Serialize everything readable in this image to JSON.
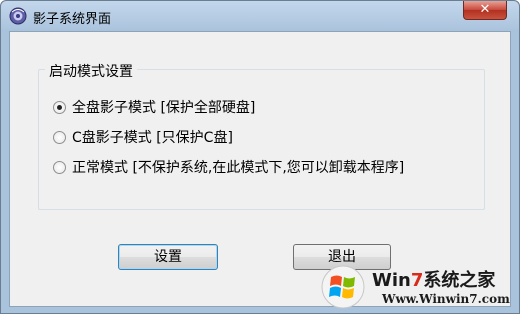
{
  "window": {
    "title": "影子系统界面",
    "close_label": "✕"
  },
  "startup_group": {
    "legend": "启动模式设置",
    "options": [
      {
        "label": "全盘影子模式 [保护全部硬盘]",
        "checked": true
      },
      {
        "label": "C盘影子模式 [只保护C盘]",
        "checked": false
      },
      {
        "label": "正常模式 [不保护系统,在此模式下,您可以卸载本程序]",
        "checked": false
      }
    ]
  },
  "buttons": {
    "settings": "设置",
    "exit": "退出"
  },
  "watermark": {
    "brand_prefix": "Win",
    "brand_number": "7",
    "brand_suffix": "系统之家",
    "url": "Www.Winwin7.com"
  },
  "colors": {
    "title_bar": "#aac3dc",
    "client_bg": "#f0f0f0",
    "close_button": "#c8473b",
    "watermark_accent": "#d92b1c"
  },
  "icons": {
    "app": "shadow-system-logo-icon",
    "close": "close-icon"
  }
}
